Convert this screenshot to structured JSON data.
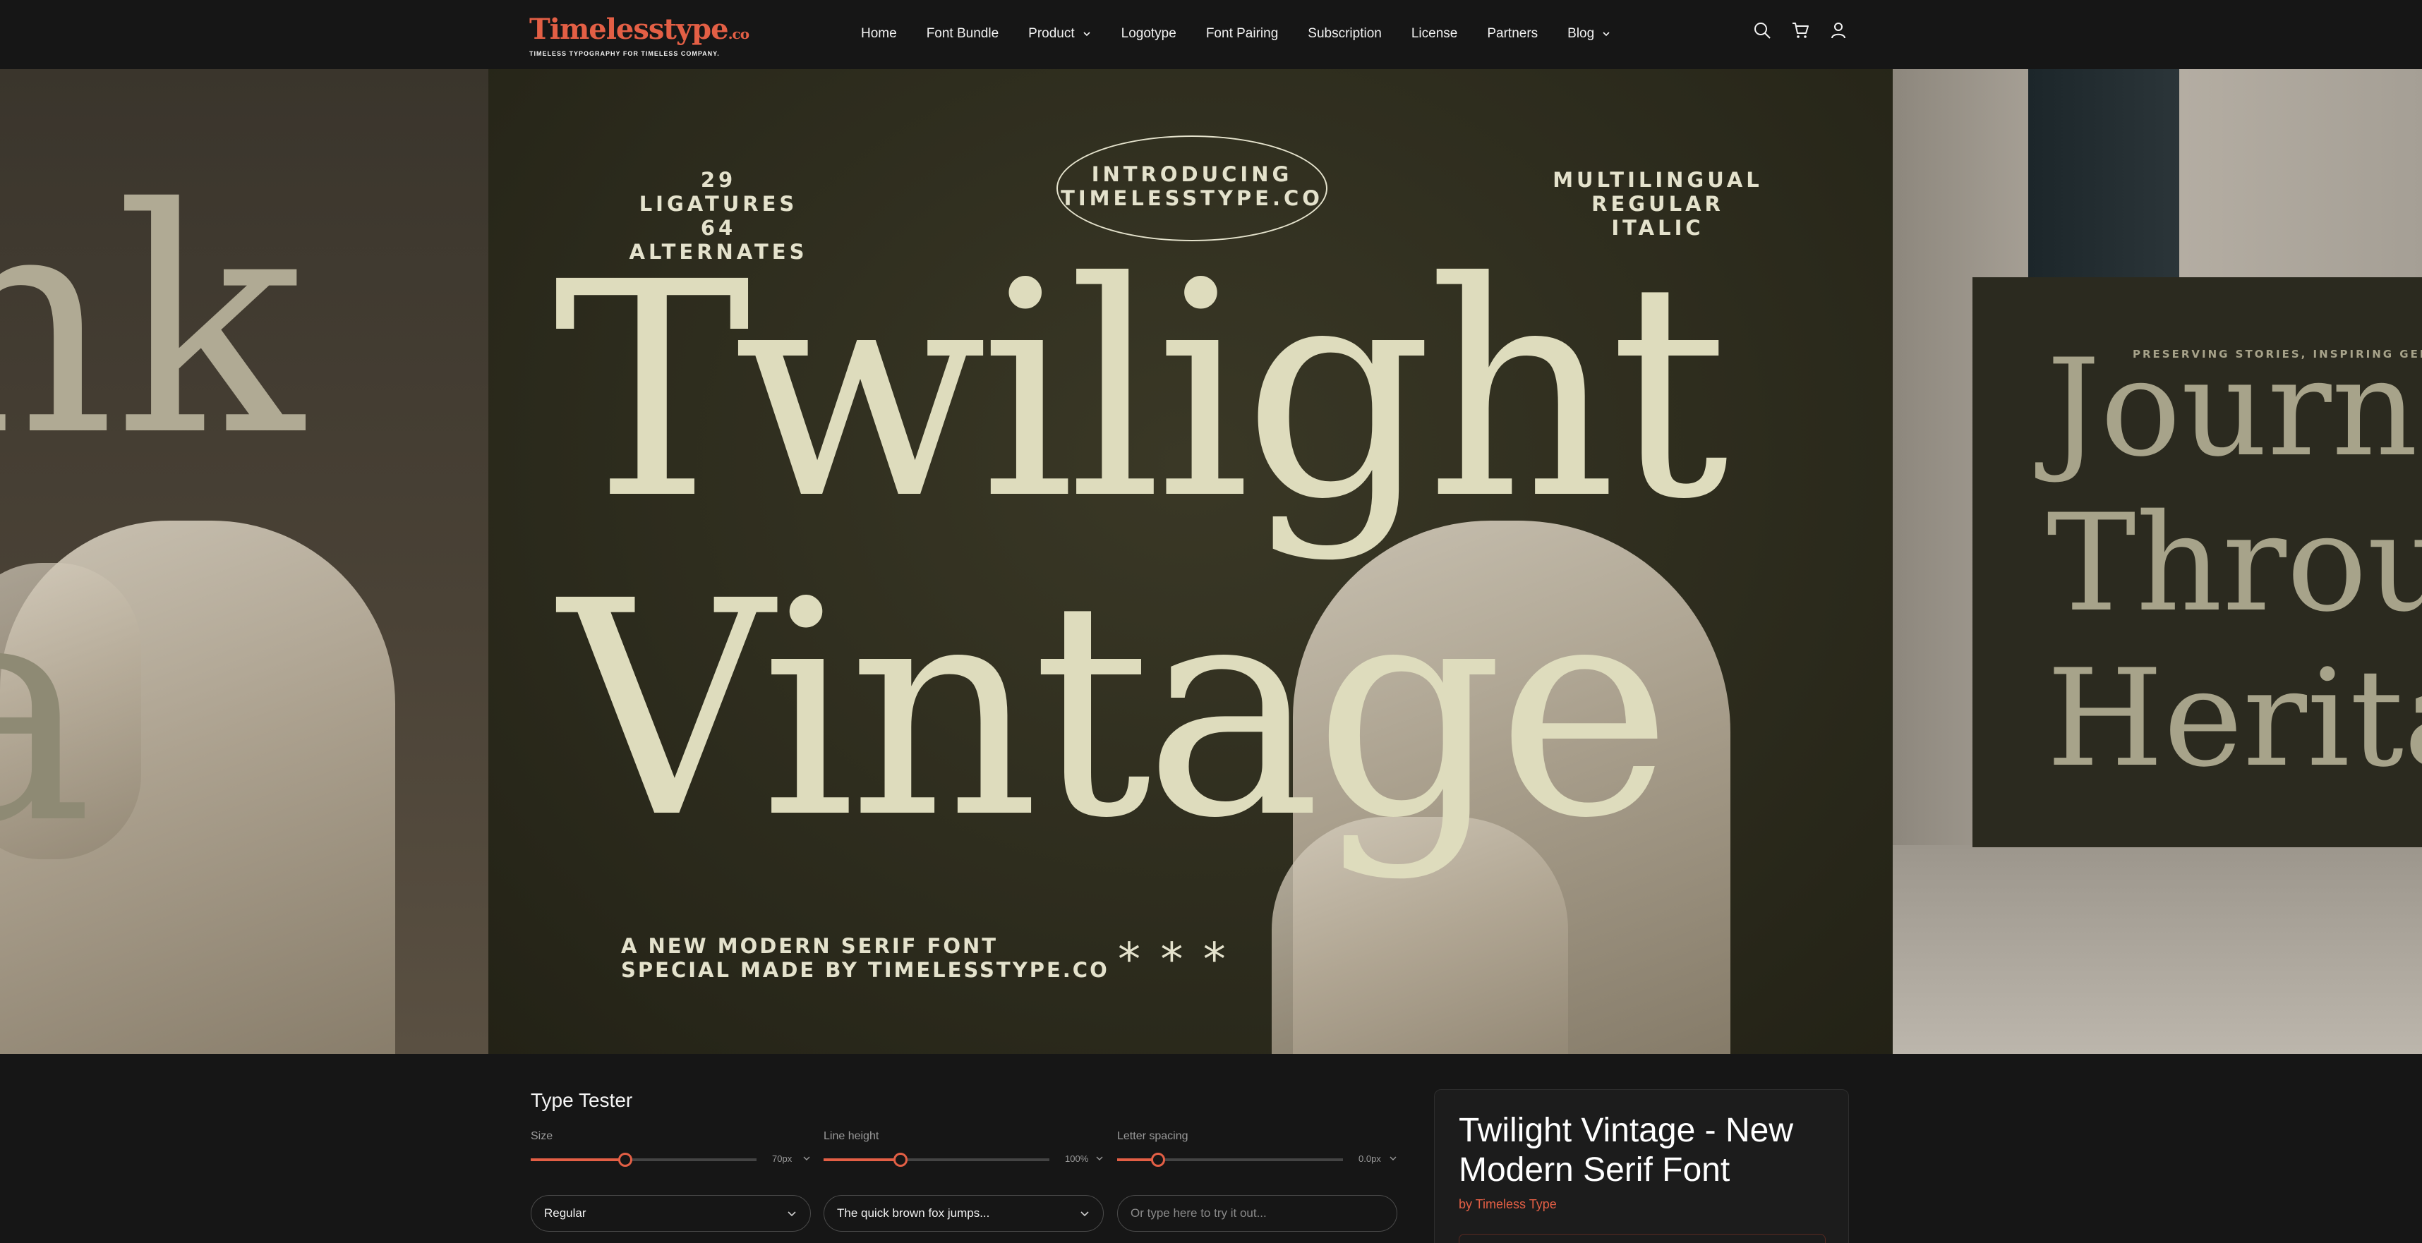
{
  "header": {
    "logo": {
      "word": "Timelesstype",
      "suffix": ".co",
      "tagline": "TIMELESS TYPOGRAPHY FOR TIMELESS COMPANY."
    },
    "nav": [
      {
        "label": "Home",
        "dropdown": false
      },
      {
        "label": "Font Bundle",
        "dropdown": false
      },
      {
        "label": "Product",
        "dropdown": true
      },
      {
        "label": "Logotype",
        "dropdown": false
      },
      {
        "label": "Font Pairing",
        "dropdown": false
      },
      {
        "label": "Subscription",
        "dropdown": false
      },
      {
        "label": "License",
        "dropdown": false
      },
      {
        "label": "Partners",
        "dropdown": false
      },
      {
        "label": "Blog",
        "dropdown": true
      }
    ],
    "icons": [
      "search-icon",
      "cart-icon",
      "account-icon"
    ]
  },
  "hero": {
    "left_letters_top": "nk",
    "left_letters_bottom": "a",
    "main": {
      "top_left": [
        "29 LIGATURES",
        "64 ALTERNATES"
      ],
      "badge": [
        "INTRODUCING",
        "TIMELESSTYPE.CO"
      ],
      "top_right": [
        "MULTILINGUAL",
        "REGULAR ITALIC"
      ],
      "headline_1": "Twilight",
      "headline_2": "Vintage",
      "bottom_left": [
        "A NEW MODERN SERIF FONT",
        "SPECIAL MADE BY TIMELESSTYPE.CO"
      ],
      "asterisks": "* * *"
    },
    "right": {
      "eyebrow": "PRESERVING STORIES, INSPIRING GENERATI",
      "lines": [
        "Journe",
        "Throu",
        "Herita"
      ]
    }
  },
  "type_tester": {
    "title": "Type Tester",
    "controls": [
      {
        "label": "Size",
        "value": "70px",
        "position": 0.42
      },
      {
        "label": "Line height",
        "value": "100%",
        "position": 0.34
      },
      {
        "label": "Letter spacing",
        "value": "0.0px",
        "position": 0.18
      }
    ],
    "weight_select": "Regular",
    "sample_select": "The quick brown fox jumps...",
    "custom_input_placeholder": "Or type here to try it out..."
  },
  "product": {
    "title": "Twilight Vintage - New Modern Serif Font",
    "by_prefix": "by",
    "author": "Timeless Type"
  },
  "colors": {
    "accent": "#e35f45",
    "background": "#161616",
    "hero_cream": "#dedcbd",
    "hero_olive": "#2b2a1c"
  }
}
